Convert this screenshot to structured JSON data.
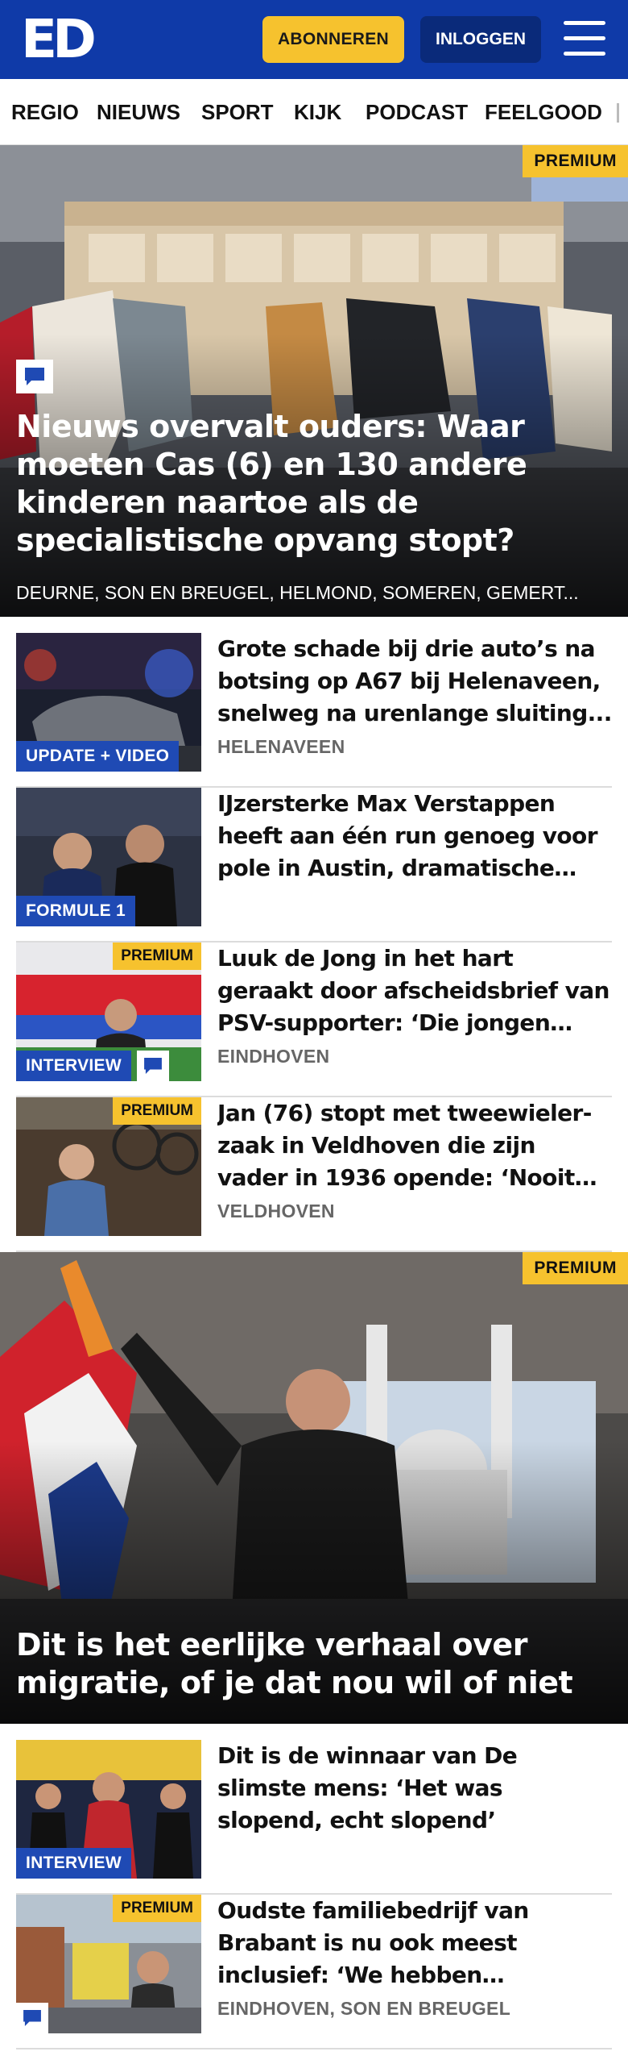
{
  "header": {
    "logo": "ED",
    "subscribe_label": "ABONNEREN",
    "login_label": "INLOGGEN",
    "menu_icon": "hamburger-menu-icon",
    "color": "#0f3aa8"
  },
  "nav": {
    "items": [
      "REGIO",
      "NIEUWS",
      "SPORT",
      "KIJK",
      "PODCAST",
      "FEELGOOD"
    ]
  },
  "hero1": {
    "badge": "PREMIUM",
    "title": "Nieuws overvalt ouders: Waar moeten Cas (6) en 130 andere kinderen naartoe als de specialistische opvang stopt?",
    "location": "DEURNE, SON EN BREUGEL, HELMOND, SOMEREN, GEMERT...",
    "icon": "comment-icon"
  },
  "articles": [
    {
      "label": "UPDATE + VIDEO",
      "title": "Grote schade bij drie auto’s na botsing op A67 bij Helenaveen, snelweg na urenlange sluiting...",
      "location": "HELENAVEEN"
    },
    {
      "label": "FORMULE 1",
      "title": "IJzersterke Max Verstappen heeft aan één run genoeg voor pole in Austin, dramatische dag...",
      "location": ""
    },
    {
      "premium": "PREMIUM",
      "label": "INTERVIEW",
      "title": "Luuk de Jong in het hart geraakt door afscheidsbrief van PSV-supporter: ‘Die jongen stond er...",
      "location": "EINDHOVEN"
    },
    {
      "premium": "PREMIUM",
      "title": "Jan (76) stopt met tweewieler-zaak in Veldhoven die zijn vader in 1936 opende: ‘Nooit een hekel...",
      "location": "VELDHOVEN"
    }
  ],
  "hero2": {
    "badge": "PREMIUM",
    "title": "Dit is het eerlijke verhaal over migratie, of je dat nou wil of niet"
  },
  "articles2": [
    {
      "label": "INTERVIEW",
      "title": "Dit is de winnaar van De slimste mens: ‘Het was slopend, echt slopend’",
      "location": ""
    },
    {
      "premium": "PREMIUM",
      "title": "Oudste familiebedrijf van Brabant is nu ook meest inclusief: ‘We hebben iedereen...",
      "location": "EINDHOVEN, SON EN BREUGEL"
    }
  ],
  "colors": {
    "brand_blue": "#0f3aa8",
    "label_blue": "#1f4ab4",
    "premium_yellow": "#f6c22e"
  }
}
